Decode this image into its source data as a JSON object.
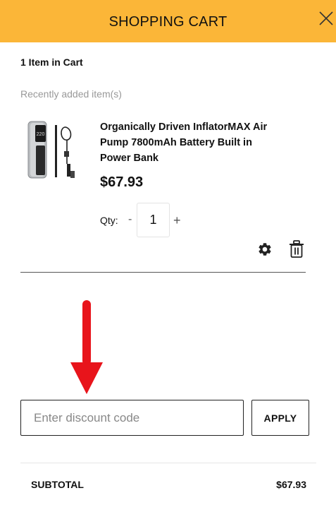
{
  "header": {
    "title": "SHOPPING CART"
  },
  "cart": {
    "count_text": "1 Item in Cart",
    "recent_label": "Recently added item(s)"
  },
  "item": {
    "name": "Organically Driven InflatorMAX Air Pump 7800mAh Battery Built in Power Bank",
    "price": "$67.93",
    "qty_label": "Qty:",
    "qty_minus": "-",
    "qty_value": "1",
    "qty_plus": "+",
    "thumb_display": "220"
  },
  "discount": {
    "placeholder": "Enter discount code",
    "apply_label": "APPLY"
  },
  "summary": {
    "subtotal_label": "SUBTOTAL",
    "subtotal_value": "$67.93"
  },
  "colors": {
    "header_bg": "#fbb638",
    "annotation_arrow": "#e8141b"
  },
  "icons": {
    "close": "close-icon",
    "settings": "gear-icon",
    "delete": "trash-icon",
    "annotation": "down-arrow-annotation"
  }
}
